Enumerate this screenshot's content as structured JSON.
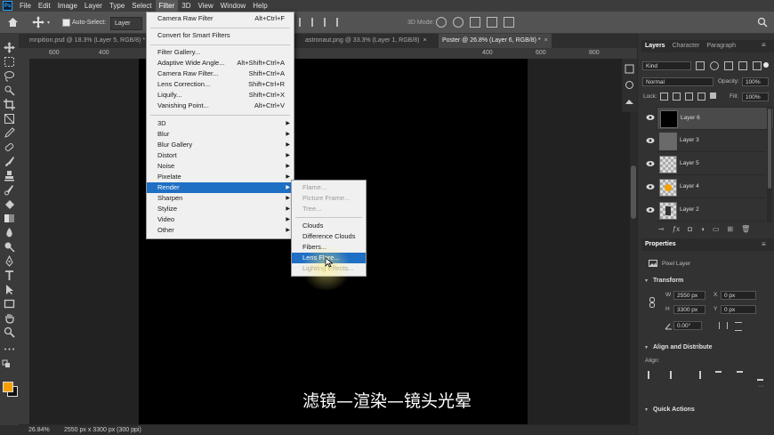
{
  "menubar": {
    "logo": "Ps",
    "items": [
      "File",
      "Edit",
      "Image",
      "Layer",
      "Type",
      "Select",
      "Filter",
      "3D",
      "View",
      "Window",
      "Help"
    ],
    "active": "Filter"
  },
  "options": {
    "auto_select_label": "Auto-Select:",
    "auto_select_value": "Layer",
    "mode_label": "3D Mode:"
  },
  "tabs": [
    {
      "label": "mnpition.psd @ 18.3% (Layer 5, RGB/8) *",
      "active": false
    },
    {
      "label": "astronaut.png @ 33.3% (Layer 1, RGB/8)",
      "active": false
    },
    {
      "label": "Poster @ 26.8% (Layer 6, RGB/8) *",
      "active": true
    }
  ],
  "ruler": {
    "ticks": [
      "600",
      "400",
      "200",
      "0",
      "200",
      "400",
      "600",
      "800"
    ]
  },
  "status": {
    "zoom": "26.84%",
    "doc_info": "2550 px x 3300 px (300 ppi)"
  },
  "filter_menu": {
    "items": [
      {
        "label": "Camera Raw Filter",
        "shortcut": "Alt+Ctrl+F"
      },
      {
        "label": "Convert for Smart Filters",
        "shortcut": ""
      },
      {
        "label": "Filter Gallery...",
        "shortcut": ""
      },
      {
        "label": "Adaptive Wide Angle...",
        "shortcut": "Alt+Shift+Ctrl+A"
      },
      {
        "label": "Camera Raw Filter...",
        "shortcut": "Shift+Ctrl+A"
      },
      {
        "label": "Lens Correction...",
        "shortcut": "Shift+Ctrl+R"
      },
      {
        "label": "Liquify...",
        "shortcut": "Shift+Ctrl+X"
      },
      {
        "label": "Vanishing Point...",
        "shortcut": "Alt+Ctrl+V"
      },
      {
        "label": "3D",
        "shortcut": ""
      },
      {
        "label": "Blur",
        "shortcut": ""
      },
      {
        "label": "Blur Gallery",
        "shortcut": ""
      },
      {
        "label": "Distort",
        "shortcut": ""
      },
      {
        "label": "Noise",
        "shortcut": ""
      },
      {
        "label": "Pixelate",
        "shortcut": ""
      },
      {
        "label": "Render",
        "shortcut": ""
      },
      {
        "label": "Sharpen",
        "shortcut": ""
      },
      {
        "label": "Stylize",
        "shortcut": ""
      },
      {
        "label": "Video",
        "shortcut": ""
      },
      {
        "label": "Other",
        "shortcut": ""
      }
    ],
    "highlighted": "Render"
  },
  "render_menu": {
    "items": [
      {
        "label": "Flame...",
        "enabled": false
      },
      {
        "label": "Picture Frame...",
        "enabled": false
      },
      {
        "label": "Tree...",
        "enabled": false
      },
      {
        "label": "Clouds",
        "enabled": true
      },
      {
        "label": "Difference Clouds",
        "enabled": true
      },
      {
        "label": "Fibers...",
        "enabled": true
      },
      {
        "label": "Lens Flare...",
        "enabled": true
      },
      {
        "label": "Lighting Effects...",
        "enabled": false
      }
    ],
    "highlighted": "Lens Flare..."
  },
  "layers_panel": {
    "tabs": [
      "Layers",
      "Character",
      "Paragraph"
    ],
    "kind_label": "Kind",
    "blend_mode": "Normal",
    "opacity_label": "Opacity:",
    "opacity": "100%",
    "lock_label": "Lock:",
    "fill_label": "Fill:",
    "fill": "100%",
    "layers": [
      {
        "name": "Layer 6",
        "selected": true,
        "thumb": "black"
      },
      {
        "name": "Layer 3",
        "selected": false,
        "thumb": "gray"
      },
      {
        "name": "Layer 5",
        "selected": false,
        "thumb": "checker"
      },
      {
        "name": "Layer 4",
        "selected": false,
        "thumb": "orange"
      },
      {
        "name": "Layer 2",
        "selected": false,
        "thumb": "figure"
      }
    ]
  },
  "properties_panel": {
    "title": "Properties",
    "type": "Pixel Layer",
    "transform_title": "Transform",
    "w_label": "W",
    "w_value": "2550 px",
    "h_label": "H",
    "h_value": "3300 px",
    "x_label": "X",
    "x_value": "0 px",
    "y_label": "Y",
    "y_value": "0 px",
    "angle": "0.00°",
    "align_title": "Align and Distribute",
    "align_label": "Align:",
    "quick_actions": "Quick Actions"
  },
  "colors": {
    "accent": "#1f6fc4",
    "foreground_swatch": "#f5a000",
    "background_swatch": "#111111"
  },
  "subtitle": "滤镜—渲染—镜头光晕"
}
